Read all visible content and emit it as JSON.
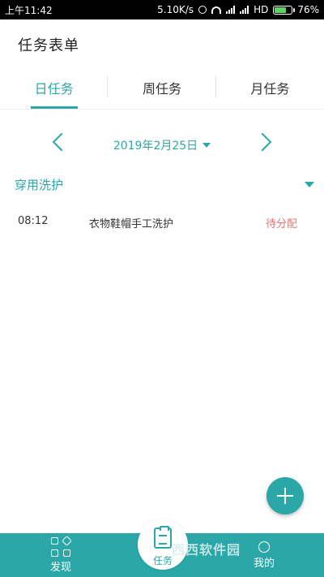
{
  "status_bar": {
    "time": "上午11:42",
    "network_speed": "5.10K/s",
    "hd": "HD",
    "battery": "76%",
    "battery_level": 0.76
  },
  "header": {
    "title": "任务表单"
  },
  "tabs": [
    {
      "label": "日任务",
      "active": true
    },
    {
      "label": "周任务",
      "active": false
    },
    {
      "label": "月任务",
      "active": false
    }
  ],
  "date_selector": {
    "date": "2019年2月25日"
  },
  "category": {
    "label": "穿用洗护"
  },
  "tasks": [
    {
      "time": "08:12",
      "name": "衣物鞋帽手工洗护",
      "status": "待分配"
    }
  ],
  "bottom_nav": {
    "discover": "发现",
    "task_label": "任务",
    "mine_label": "我的"
  },
  "colors": {
    "accent": "#2aa7a6",
    "status_pending": "#e57373"
  },
  "watermark": "西西软件园"
}
